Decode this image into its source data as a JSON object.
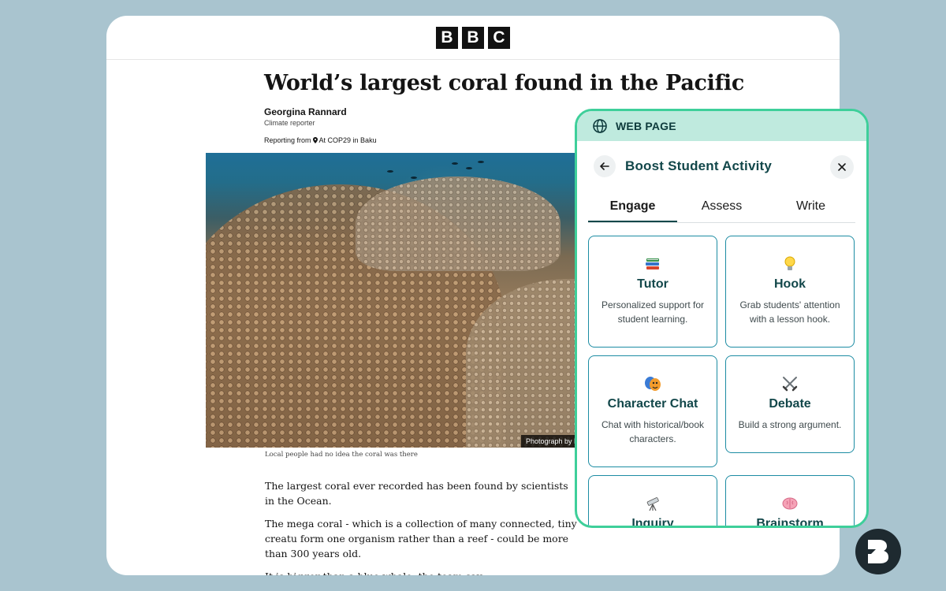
{
  "masthead": {
    "letters": [
      "B",
      "B",
      "C"
    ]
  },
  "article": {
    "headline": "World’s largest coral found in the Pacific",
    "author": "Georgina Rannard",
    "role": "Climate reporter",
    "reporting_prefix": "Reporting from",
    "reporting_location": "At COP29 in Baku",
    "photo_credit": "Photograph by N",
    "caption": "Local people had no idea the coral was there",
    "paragraphs": [
      "The largest coral ever recorded has been found by scientists in the Ocean.",
      "The mega coral - which is a collection of many connected, tiny creatu form one organism rather than a reef - could be more than 300 years old.",
      "It is bigger than a blue whale, the team say."
    ]
  },
  "panel": {
    "header_label": "WEB PAGE",
    "title": "Boost Student Activity",
    "tabs": [
      {
        "label": "Engage",
        "active": true
      },
      {
        "label": "Assess",
        "active": false
      },
      {
        "label": "Write",
        "active": false
      }
    ],
    "cards": [
      {
        "icon": "books-icon",
        "name": "Tutor",
        "desc": "Personalized support for student learning."
      },
      {
        "icon": "lightbulb-icon",
        "name": "Hook",
        "desc": "Grab students' attention with a lesson hook."
      },
      {
        "icon": "theater-masks-icon",
        "name": "Character Chat",
        "desc": "Chat with historical/book characters."
      },
      {
        "icon": "crossed-swords-icon",
        "name": "Debate",
        "desc": "Build a strong argument."
      },
      {
        "icon": "telescope-icon",
        "name": "Inquiry",
        "desc": ""
      },
      {
        "icon": "brain-icon",
        "name": "Brainstorm",
        "desc": ""
      }
    ]
  },
  "colors": {
    "accent": "#3ecf9a",
    "panel_header_bg": "#bfeade",
    "card_border": "#1c8ca3",
    "title_text": "#12474a",
    "background": "#a9c4cf"
  }
}
